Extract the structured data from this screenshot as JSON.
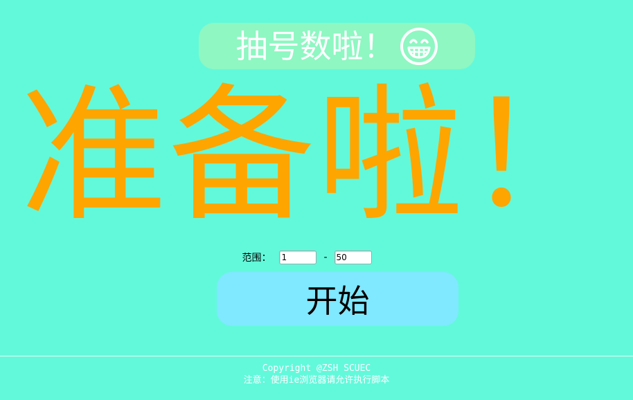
{
  "header": {
    "title": "抽号数啦！",
    "icon": "grinning-face-icon"
  },
  "main": {
    "display_text": "准备啦！",
    "display_color": "#ffa500"
  },
  "range": {
    "label": "范围：",
    "min_value": "1",
    "separator": "-",
    "max_value": "50"
  },
  "actions": {
    "start_label": "开始"
  },
  "footer": {
    "copyright": "Copyright @ZSH SCUEC",
    "notice": "注意：使用ie浏览器请允许执行脚本"
  },
  "colors": {
    "background": "#62f9db",
    "title_pill": "#8ef7c2",
    "button": "#80e8ff"
  }
}
